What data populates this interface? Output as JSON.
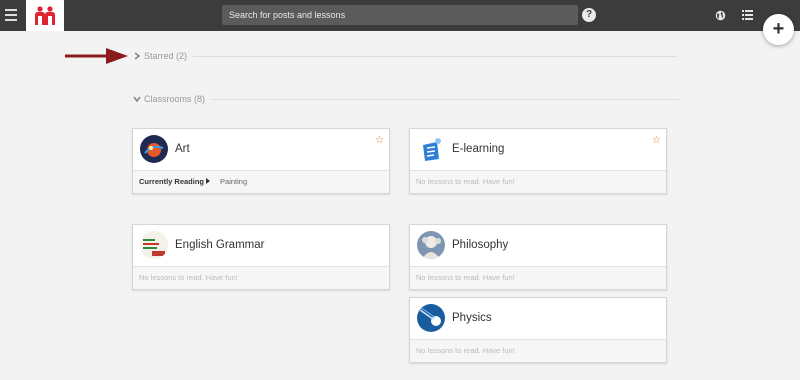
{
  "topbar": {
    "search_placeholder": "Search for posts and lessons",
    "help_label": "?",
    "add_label": "+"
  },
  "sections": {
    "starred_label": "Starred (2)",
    "classrooms_label": "Classrooms (8)"
  },
  "cards": {
    "art": {
      "title": "Art",
      "reading_label": "Currently Reading",
      "lesson": "Painting"
    },
    "elearning": {
      "title": "E-learning",
      "empty": "No lessons to read. Have fun!"
    },
    "english": {
      "title": "English Grammar",
      "empty": "No lessons to read. Have fun!"
    },
    "philosophy": {
      "title": "Philosophy",
      "empty": "No lessons to read. Have fun!"
    },
    "physics": {
      "title": "Physics",
      "empty": "No lessons to read. Have fun!"
    }
  },
  "colors": {
    "topbar": "#3c3c3c",
    "brand_red": "#e0232f",
    "star": "#e07a1f",
    "annotation_arrow": "#8b1a1a"
  },
  "icons": {
    "menu": "hamburger-icon",
    "logo": "brand-logo",
    "help": "help-icon",
    "globe": "globe-icon",
    "list": "list-icon",
    "add": "plus-icon",
    "star": "star-icon",
    "chevron": "chevron-icon"
  }
}
